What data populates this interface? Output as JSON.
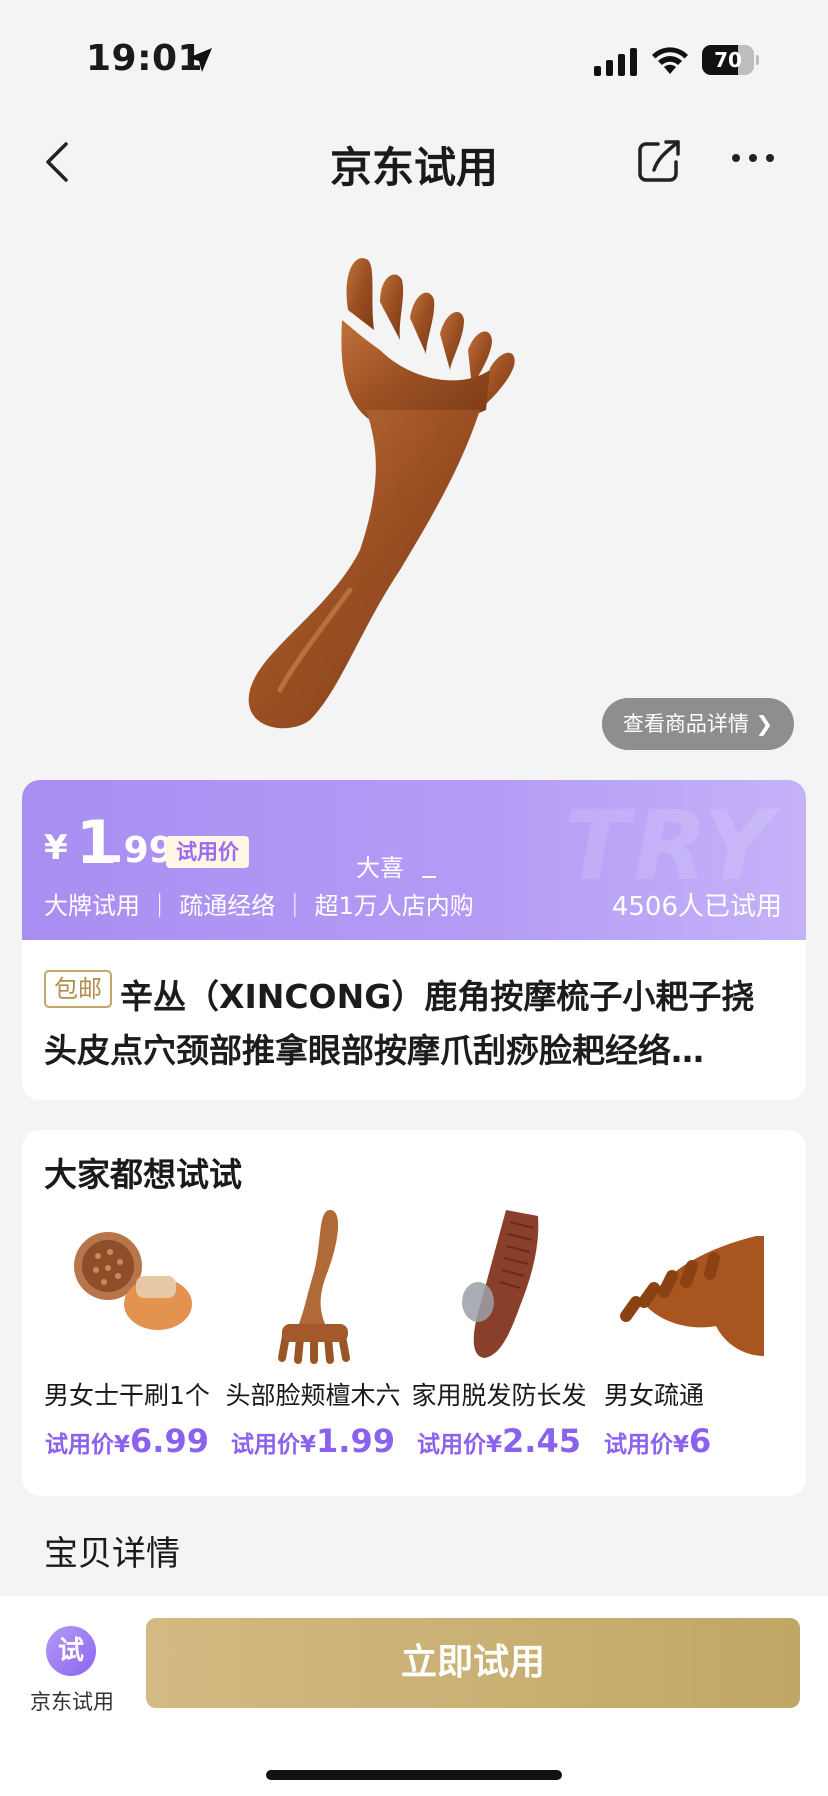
{
  "status_bar": {
    "time": "19:01",
    "battery_level": 70,
    "battery_text": "70"
  },
  "nav": {
    "title": "京东试用"
  },
  "hero": {
    "detail_link": "查看商品详情 ❯"
  },
  "price_card": {
    "currency": "¥",
    "price_int": "1",
    "price_dec": ".99",
    "price_tag": "试用价",
    "promo_text": "大喜",
    "watermark": "TRY",
    "features": "大牌试用 ｜ 疏通经络 ｜ 超1万人店内购",
    "tried_count": "4506人已试用",
    "free_ship_badge": "包邮",
    "product_title": "辛丛（XINCONG）鹿角按摩梳子小耙子挠头皮点穴颈部推拿眼部按摩爪刮痧脸耙经络…"
  },
  "recommendations": {
    "title": "大家都想试试",
    "items": [
      {
        "name": "男女士干刷1个",
        "price_label": "试用价¥",
        "price": "6.99",
        "icon": "massage-brush-icon"
      },
      {
        "name": "头部脸颊檀木六",
        "price_label": "试用价¥",
        "price": "1.99",
        "icon": "wooden-rake-icon"
      },
      {
        "name": "家用脱发防长发",
        "price_label": "试用价¥",
        "price": "2.45",
        "icon": "wooden-comb-icon"
      },
      {
        "name": "男女疏通",
        "price_label": "试用价¥",
        "price": "6",
        "icon": "wooden-claw-icon"
      }
    ]
  },
  "section": {
    "baobei": "宝贝详情"
  },
  "bottom_bar": {
    "jd_try_icon_char": "试",
    "jd_try_label": "京东试用",
    "try_button": "立即试用"
  },
  "colors": {
    "accent_purple": "#8a62ee",
    "band_purple": "#a98ef2",
    "gold_button": "#c9b070"
  }
}
